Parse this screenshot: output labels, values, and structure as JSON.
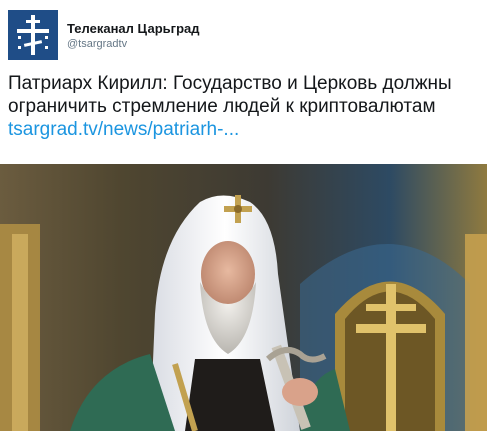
{
  "author": {
    "display_name": "Телеканал Царьград",
    "handle": "@tsargradtv",
    "avatar_icon": "orthodox-cross-logo-icon",
    "avatar_color": "#1f4d87"
  },
  "tweet": {
    "text_line_1": "Патриарх Кирилл: Государство и Церковь должны",
    "text_line_2": "ограничить стремление людей к криптовалютам",
    "link": "tsargrad.tv/news/patriarh-..."
  },
  "colors": {
    "link": "#1b95e0",
    "text": "#14171a",
    "handle": "#657786"
  }
}
